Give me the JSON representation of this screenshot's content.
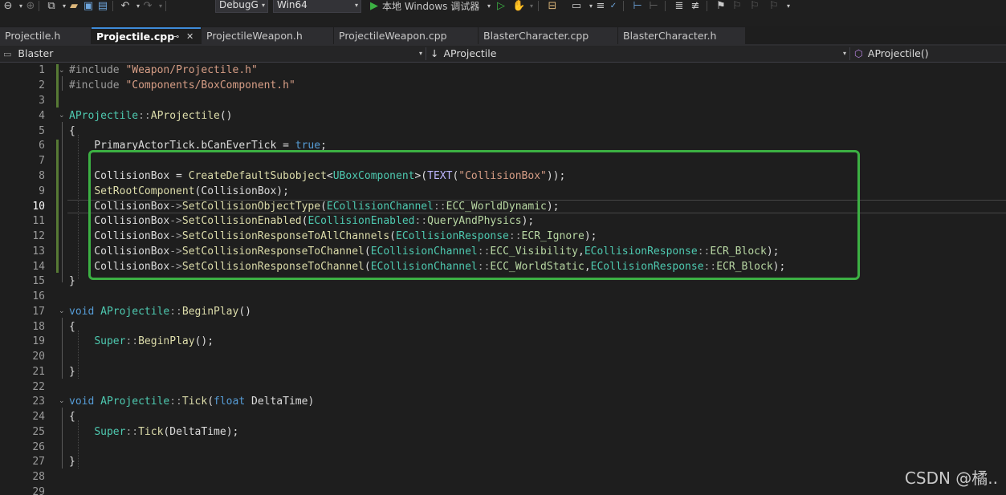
{
  "toolbar": {
    "config": "DebugG",
    "platform": "Win64",
    "run_label": "本地 Windows 调试器"
  },
  "tabs": [
    {
      "label": "Projectile.h"
    },
    {
      "label": "Projectile.cpp"
    },
    {
      "label": "ProjectileWeapon.h"
    },
    {
      "label": "ProjectileWeapon.cpp"
    },
    {
      "label": "BlasterCharacter.cpp"
    },
    {
      "label": "BlasterCharacter.h"
    }
  ],
  "navbar": {
    "project": "Blaster",
    "scope": "AProjectile",
    "member": "AProjectile()"
  },
  "editor": {
    "current_line": 10,
    "lines": [
      {
        "n": "1",
        "t": "#include \"Weapon/Projectile.h\""
      },
      {
        "n": "2",
        "t": "#include \"Components/BoxComponent.h\""
      },
      {
        "n": "3",
        "t": ""
      },
      {
        "n": "4",
        "t": "AProjectile::AProjectile()"
      },
      {
        "n": "5",
        "t": "{"
      },
      {
        "n": "6",
        "t": "    PrimaryActorTick.bCanEverTick = true;"
      },
      {
        "n": "7",
        "t": ""
      },
      {
        "n": "8",
        "t": "    CollisionBox = CreateDefaultSubobject<UBoxComponent>(TEXT(\"CollisionBox\"));"
      },
      {
        "n": "9",
        "t": "    SetRootComponent(CollisionBox);"
      },
      {
        "n": "10",
        "t": "    CollisionBox->SetCollisionObjectType(ECollisionChannel::ECC_WorldDynamic);"
      },
      {
        "n": "11",
        "t": "    CollisionBox->SetCollisionEnabled(ECollisionEnabled::QueryAndPhysics);"
      },
      {
        "n": "12",
        "t": "    CollisionBox->SetCollisionResponseToAllChannels(ECollisionResponse::ECR_Ignore);"
      },
      {
        "n": "13",
        "t": "    CollisionBox->SetCollisionResponseToChannel(ECollisionChannel::ECC_Visibility,ECollisionResponse::ECR_Block);"
      },
      {
        "n": "14",
        "t": "    CollisionBox->SetCollisionResponseToChannel(ECollisionChannel::ECC_WorldStatic,ECollisionResponse::ECR_Block);"
      },
      {
        "n": "15",
        "t": "}"
      },
      {
        "n": "16",
        "t": ""
      },
      {
        "n": "17",
        "t": "void AProjectile::BeginPlay()"
      },
      {
        "n": "18",
        "t": "{"
      },
      {
        "n": "19",
        "t": "    Super::BeginPlay();"
      },
      {
        "n": "20",
        "t": ""
      },
      {
        "n": "21",
        "t": "}"
      },
      {
        "n": "22",
        "t": ""
      },
      {
        "n": "23",
        "t": "void AProjectile::Tick(float DeltaTime)"
      },
      {
        "n": "24",
        "t": "{"
      },
      {
        "n": "25",
        "t": "    Super::Tick(DeltaTime);"
      },
      {
        "n": "26",
        "t": ""
      },
      {
        "n": "27",
        "t": "}"
      },
      {
        "n": "28",
        "t": ""
      },
      {
        "n": "29",
        "t": ""
      }
    ]
  },
  "watermark": "CSDN @橘.."
}
